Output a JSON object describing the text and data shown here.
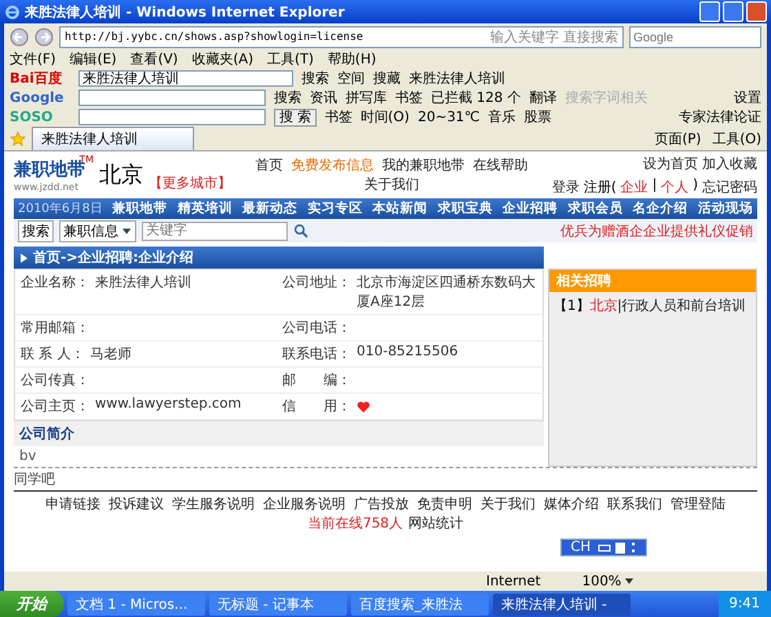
{
  "window": {
    "title": "来胜法律人培训 - Windows Internet Explorer"
  },
  "address_bar": {
    "url": "http://bj.yybc.cn/shows.asp?showlogin=license",
    "search_hint": "输入关键字 直接搜索",
    "search_placeholder": "Google"
  },
  "menu": [
    "文件(F)",
    "编辑(E)",
    "查看(V)",
    "收藏夹(A)",
    "工具(T)",
    "帮助(H)"
  ],
  "toolbars": [
    {
      "kind": "baidu",
      "logo": "Bai百度",
      "field": "来胜法律人培训",
      "items": [
        {
          "label": "搜索",
          "disabled": false
        },
        {
          "label": "空间",
          "disabled": false
        },
        {
          "label": "搜藏",
          "disabled": false
        },
        {
          "label": "来胜法律人培训",
          "disabled": false
        }
      ]
    },
    {
      "kind": "google",
      "logo": "Google",
      "items": [
        {
          "label": "搜索",
          "disabled": false
        },
        {
          "label": "资讯",
          "disabled": false
        },
        {
          "label": "拼写库",
          "disabled": false
        },
        {
          "label": "书签",
          "disabled": false
        },
        {
          "label": "已拦截 128 个",
          "disabled": false
        },
        {
          "label": "翻译",
          "disabled": false
        },
        {
          "label": "搜索字词相关",
          "disabled": true
        }
      ],
      "right": "设置"
    },
    {
      "kind": "soso",
      "logo": "SOSO",
      "button": "搜 索",
      "items": [
        {
          "label": "书签",
          "disabled": false
        },
        {
          "label": "时间(O)",
          "disabled": false
        },
        {
          "label": "20~31℃",
          "disabled": false
        },
        {
          "label": "音乐",
          "disabled": false
        },
        {
          "label": "股票",
          "disabled": false
        }
      ],
      "right": "专家法律论证"
    }
  ],
  "tabs": [
    {
      "label": "来胜法律人培训",
      "selected": true
    }
  ],
  "command_bar": [
    "页面(P)",
    "工具(O)"
  ],
  "page": {
    "logo": {
      "text": "兼职地带",
      "url": "www.jzdd.net",
      "mark": "TM"
    },
    "city": "北京",
    "more_cities": "【更多城市】",
    "top_links": [
      {
        "label": "首页",
        "highlight": false
      },
      {
        "label": "免费发布信息",
        "highlight": true
      },
      {
        "label": "我的兼职地带",
        "highlight": false
      },
      {
        "label": "在线帮助",
        "highlight": false
      },
      {
        "label": "关于我们",
        "highlight": false
      }
    ],
    "user_links": [
      "设为首页",
      "加入收藏"
    ],
    "login": {
      "login": "登录",
      "register": "注册(",
      "company": "企业",
      "sep": "|",
      "person": "个人",
      "close": ")",
      "forgot": "忘记密码"
    },
    "date": "2010年6月8日",
    "nav": [
      "兼职地带",
      "精英培训",
      "最新动态",
      "实习专区",
      "本站新闻",
      "求职宝典",
      "企业招聘",
      "求职会员",
      "名企介绍",
      "活动现场"
    ],
    "search": {
      "label": "搜索",
      "category": "兼职信息",
      "placeholder": "关键字"
    },
    "promo": "优兵为赠酒企企业提供礼仪促销",
    "breadcrumb": "首页->企业招聘:企业介绍",
    "fields": [
      {
        "label": "企业名称：",
        "value": "来胜法律人培训"
      },
      {
        "label": "公司地址：",
        "value": "北京市海淀区四通桥东数码大厦A座12层"
      },
      {
        "label": "常用邮箱："
      },
      {
        "label": "公司电话："
      },
      {
        "label": "联 系 人：",
        "value": "马老师"
      },
      {
        "label": "联系电话：",
        "value": "010-85215506"
      },
      {
        "label": "公司传真："
      },
      {
        "label": "邮　　编："
      },
      {
        "label": "公司主页：",
        "value": "www.lawyerstep.com"
      },
      {
        "label": "信　　用：",
        "kind": "credit"
      }
    ],
    "intro_title": "公司简介",
    "intro": "bv",
    "related": {
      "title": "相关招聘",
      "items": [
        {
          "index": "【1】",
          "city": "北京",
          "title": "|行政人员和前台培训"
        }
      ]
    },
    "bottom_note": "同学吧",
    "footer_links": [
      "申请链接",
      "投诉建议",
      "学生服务说明",
      "企业服务说明",
      "广告投放",
      "免责申明",
      "关于我们",
      "媒体介绍",
      "联系我们",
      "管理登陆"
    ],
    "online": "当前在线758人",
    "stats": "网站统计",
    "ime": "CH"
  },
  "status_bar": {
    "zone": "Internet",
    "zoom": "100%"
  },
  "taskbar": {
    "start": "开始",
    "items": [
      {
        "label": "文档 1 - Micros...",
        "selected": false
      },
      {
        "label": "无标题 - 记事本",
        "selected": false
      },
      {
        "label": "百度搜索_来胜法",
        "selected": false
      },
      {
        "label": "来胜法律人培训 -",
        "selected": true
      }
    ],
    "clock": "9:41"
  }
}
